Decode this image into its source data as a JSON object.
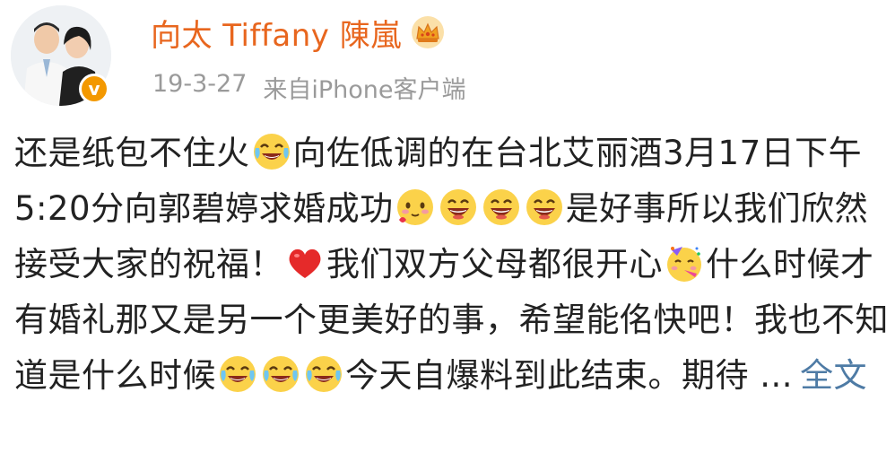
{
  "header": {
    "username": "向太 Tiffany 陳嵐",
    "date": "19-3-27",
    "source": "来自iPhone客户端",
    "verified_badge": "v",
    "badge_icon": "crown-icon",
    "accent_color": "#e8661e",
    "verify_color": "#f39800"
  },
  "post": {
    "seg1": "还是纸包不住火",
    "seg2": "向佐低调的在台北艾丽酒3月17日下午5:20分向郭碧婷求婚成功",
    "seg3": "是好事所以我们欣然接受大家的祝福！",
    "seg4": "我们双方父母都很开心",
    "seg5": "什么时候才有婚礼那又是另一个更美好的事，希望能佲快吧！我也不知道是什么时候",
    "seg6": "今天自爆料到此结束。期待",
    "ellipsis": "...",
    "more_label": "全文",
    "link_color": "#4e7ba5"
  },
  "emojis": {
    "laugh_cry": "laugh-cry-emoji",
    "blush": "blush-emoji",
    "grin": "grin-emoji",
    "heart": "heart-emoji",
    "party": "party-emoji"
  }
}
